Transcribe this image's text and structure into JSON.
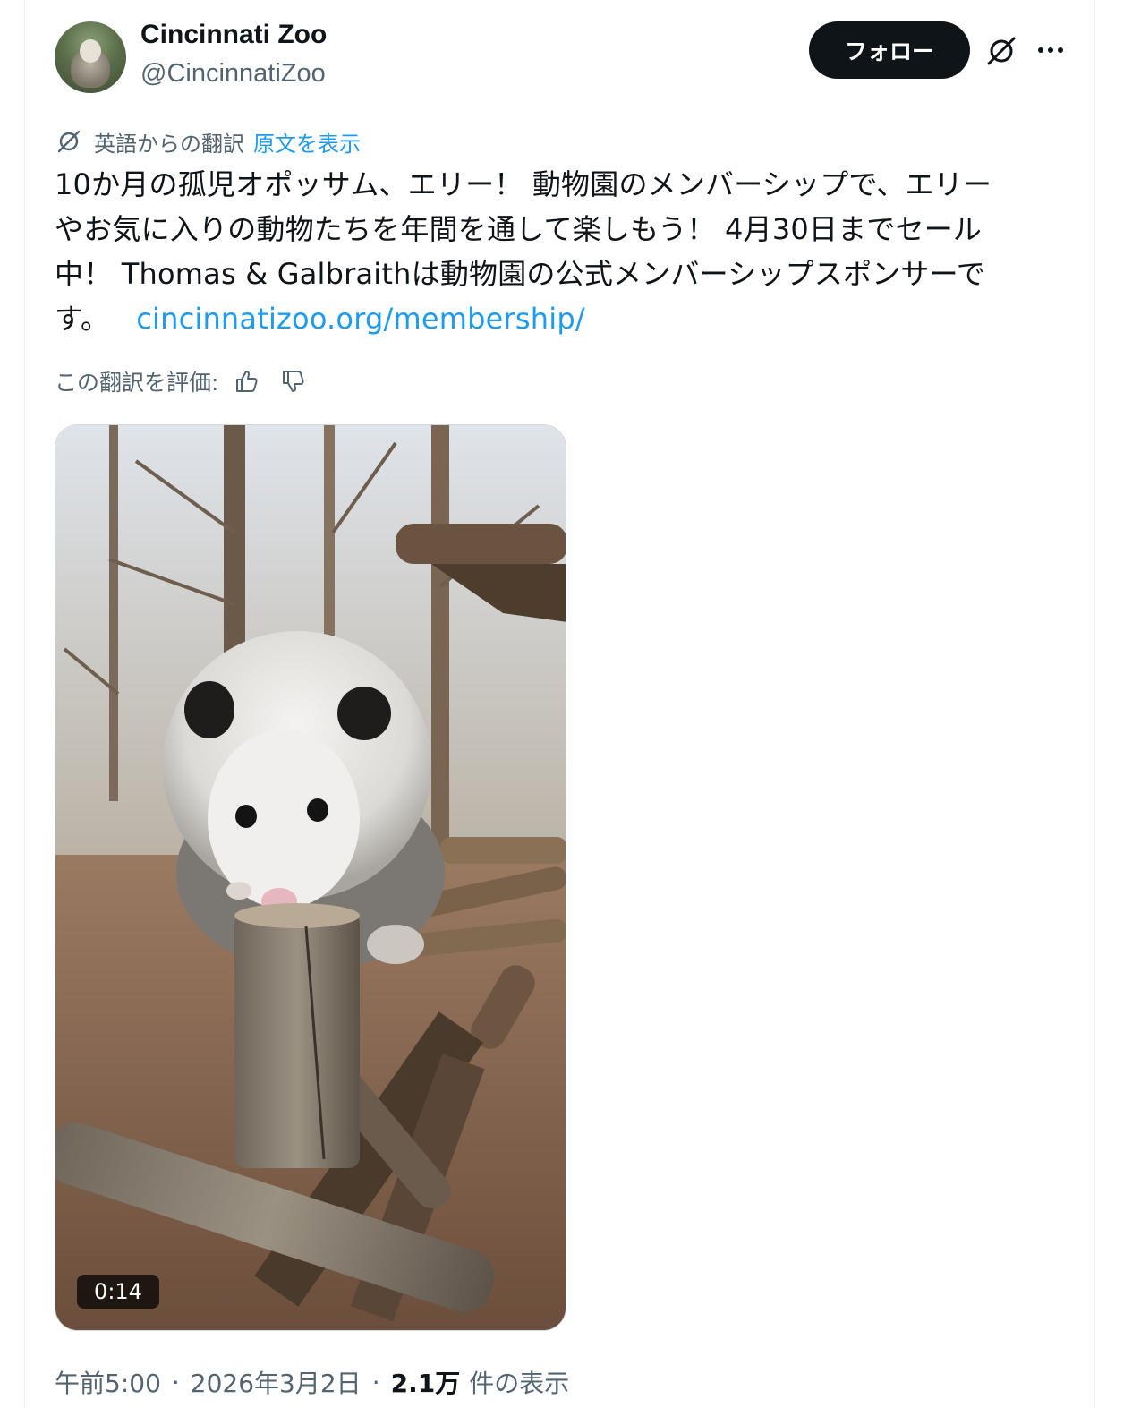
{
  "author": {
    "name": "Cincinnati Zoo",
    "handle": "@CincinnatiZoo"
  },
  "header": {
    "follow_label": "フォロー",
    "grok_icon": "grok-icon",
    "more_icon": "more-icon"
  },
  "translation": {
    "label": "英語からの翻訳",
    "show_original": "原文を表示",
    "rate_label": "この翻訳を評価:"
  },
  "tweet": {
    "lines": [
      "10か月の孤児オポッサム、エリー！ 動物園のメンバーシップで、エリー",
      "やお気に入りの動物たちを年間を通して楽しもう！ 4月30日までセール",
      "中！ Thomas & Galbraithは動物園の公式メンバーシップスポンサーで",
      "す。"
    ],
    "link": "cincinnatizoo.org/membership/"
  },
  "media": {
    "duration": "0:14",
    "description_icon": "video-thumbnail"
  },
  "meta": {
    "time": "午前5:00",
    "separator": "·",
    "date": "2026年3月2日",
    "views_count": "2.1万",
    "views_label": "件の表示"
  },
  "colors": {
    "accent": "#1d9bf0",
    "text_primary": "#0f1419",
    "text_secondary": "#536471",
    "button_dark": "#0f1419",
    "border": "#cfd9de"
  }
}
